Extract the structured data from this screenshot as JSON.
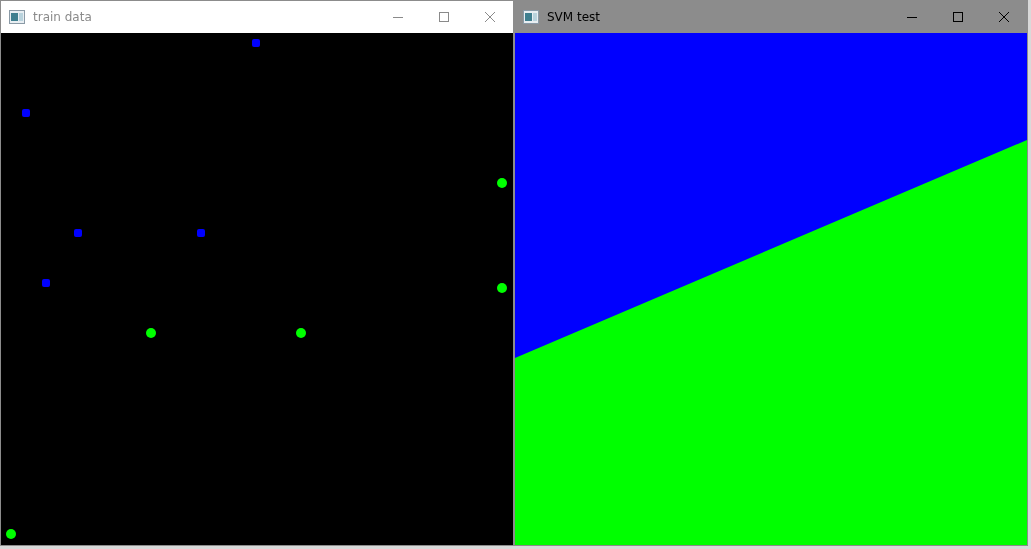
{
  "windows": [
    {
      "title": "train data",
      "focused": false,
      "kind": "scatter"
    },
    {
      "title": "SVM test",
      "focused": true,
      "kind": "regions"
    }
  ]
}
